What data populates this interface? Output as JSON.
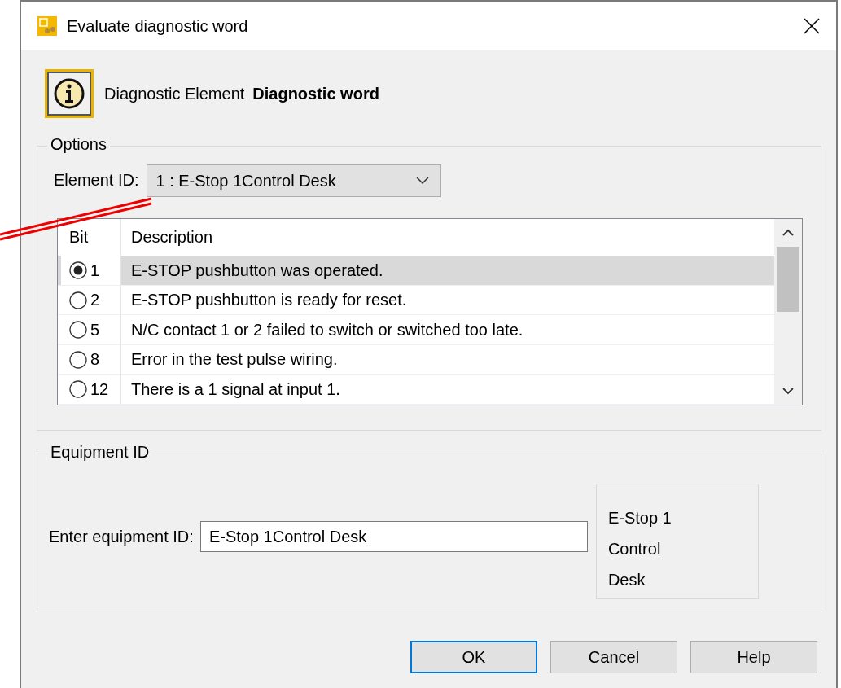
{
  "window": {
    "title": "Evaluate diagnostic word"
  },
  "header": {
    "label": "Diagnostic Element",
    "value": "Diagnostic word"
  },
  "options": {
    "title": "Options",
    "element_id_label": "Element ID:",
    "element_id_value": "1 : E-Stop 1Control Desk",
    "table": {
      "columns": [
        "Bit",
        "Description"
      ],
      "rows": [
        {
          "bit": "1",
          "description": "E-STOP pushbutton was operated.",
          "selected": true
        },
        {
          "bit": "2",
          "description": "E-STOP pushbutton is ready for reset.",
          "selected": false
        },
        {
          "bit": "5",
          "description": "N/C contact 1 or 2 failed to switch or switched too late.",
          "selected": false
        },
        {
          "bit": "8",
          "description": "Error in the test pulse wiring.",
          "selected": false
        },
        {
          "bit": "12",
          "description": "There is a 1 signal at input 1.",
          "selected": false
        }
      ]
    }
  },
  "equipment": {
    "title": "Equipment ID",
    "label": "Enter equipment ID:",
    "value": "E-Stop 1Control Desk",
    "preview_lines": [
      "E-Stop 1",
      "Control",
      "Desk"
    ]
  },
  "buttons": [
    {
      "label": "OK",
      "kind": "default"
    },
    {
      "label": "Cancel",
      "kind": "normal"
    },
    {
      "label": "Help",
      "kind": "normal"
    }
  ]
}
